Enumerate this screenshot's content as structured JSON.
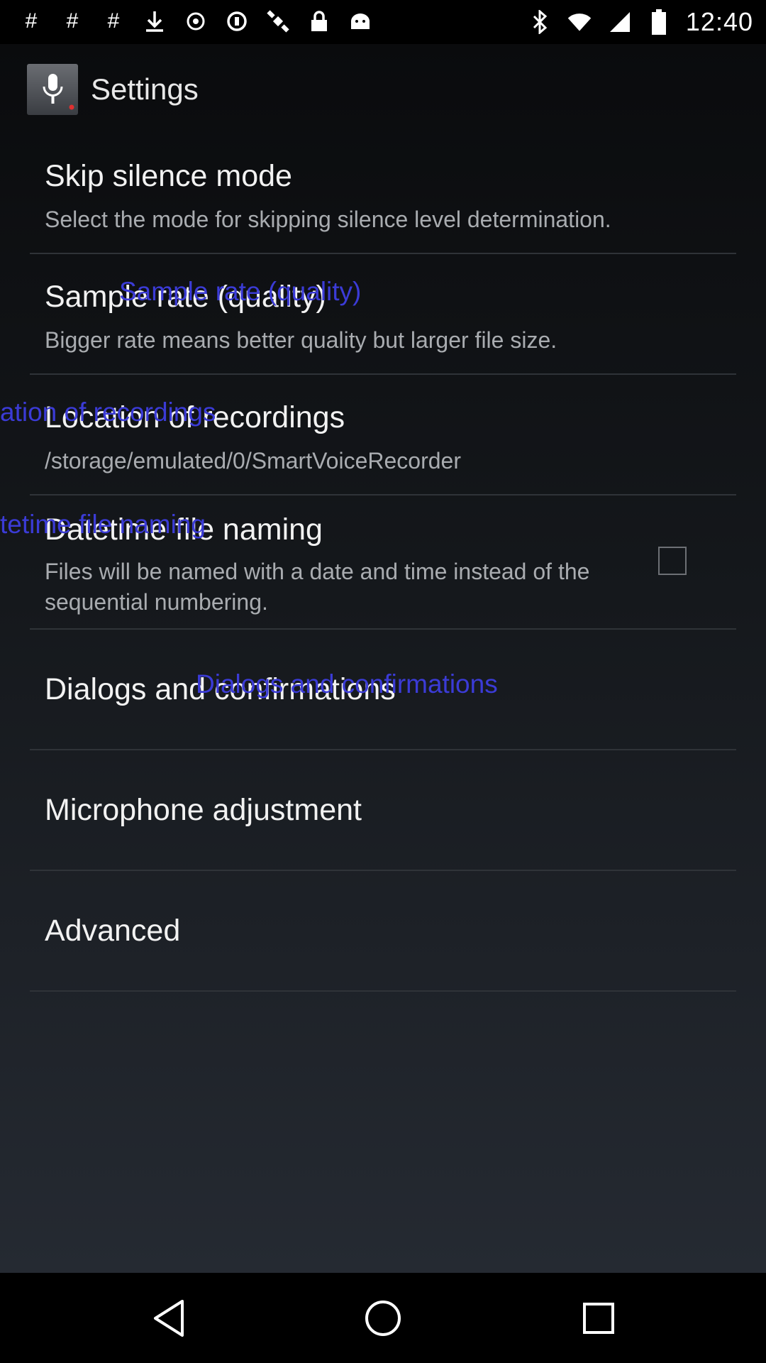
{
  "status_bar": {
    "time": "12:40",
    "left_icons": [
      "hash-icon",
      "hash-icon",
      "hash-icon",
      "download-icon",
      "media-icon",
      "sync-icon",
      "satellite-icon",
      "lock-icon",
      "android-icon"
    ],
    "right_icons": [
      "bluetooth-icon",
      "wifi-icon",
      "signal-icon",
      "battery-icon"
    ]
  },
  "action_bar": {
    "title": "Settings"
  },
  "preferences": [
    {
      "title": "Skip silence mode",
      "summary": "Select the mode for skipping silence level determination."
    },
    {
      "title": "Sample rate (quality)",
      "summary": "Bigger rate means better quality but larger file size.",
      "overlay": "Sample rate (quality)"
    },
    {
      "title": "Location of recordings",
      "summary": "/storage/emulated/0/SmartVoiceRecorder",
      "overlay": "ation of recordings"
    },
    {
      "title": "Datetime file naming",
      "summary": "Files will be named with a date and time instead of the sequential numbering.",
      "overlay": "tetime file naming",
      "checked": false
    },
    {
      "title": "Dialogs and confirmations",
      "overlay": "Dialogs and confirmations"
    },
    {
      "title": "Microphone adjustment"
    },
    {
      "title": "Advanced"
    }
  ],
  "colors": {
    "overlay_text": "#3b3bd6",
    "title_text": "#f2f2f2",
    "summary_text": "#a9acb0"
  },
  "nav_bar": {
    "buttons": [
      "back-icon",
      "home-icon",
      "recents-icon"
    ]
  }
}
